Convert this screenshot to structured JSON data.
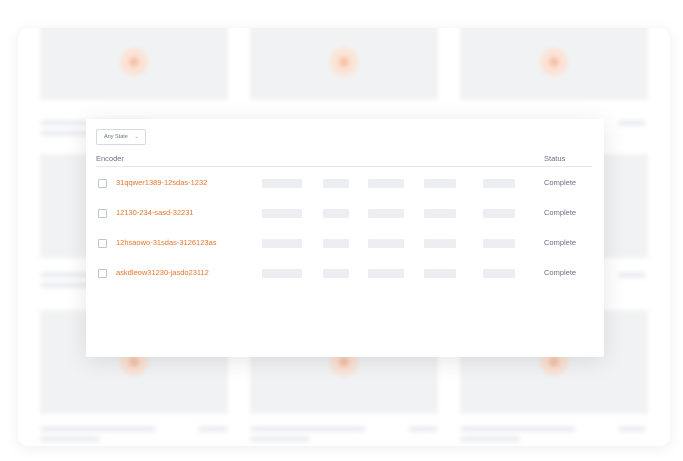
{
  "filter": {
    "selected": "Any State",
    "chevron": "⌄"
  },
  "table": {
    "columns": {
      "encoder": "Encoder",
      "status": "Status"
    },
    "rows": [
      {
        "encoder": "31qqwer1389-12sdas-1232",
        "status": "Complete"
      },
      {
        "encoder": "12130-234-sasd-32231",
        "status": "Complete"
      },
      {
        "encoder": "12hsaowo-31sdas-3126123as",
        "status": "Complete"
      },
      {
        "encoder": "askdleow31230-jasdo23112",
        "status": "Complete"
      }
    ]
  },
  "colors": {
    "accent": "#e8742a",
    "text_muted": "#6b7280",
    "placeholder": "#eceef1"
  },
  "icons": {
    "background_thumbnail": "play-icon",
    "dropdown": "chevron-down-icon"
  }
}
